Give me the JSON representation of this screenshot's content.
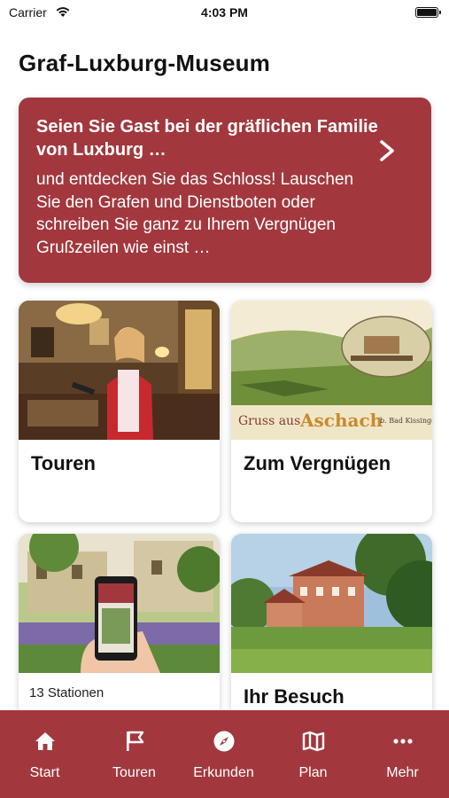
{
  "status_bar": {
    "carrier": "Carrier",
    "time": "4:03 PM"
  },
  "header": {
    "title": "Graf-Luxburg-Museum"
  },
  "hero": {
    "title": "Seien Sie Gast bei der gräflichen Familie von Luxburg …",
    "body": "und entdecken Sie das Schloss! Lauschen Sie den Grafen und Dienstboten oder schreiben Sie ganz zu Ihrem Vergnügen Grußzeilen wie einst …",
    "accent_color": "#a2383e"
  },
  "tiles": [
    {
      "label": "Touren",
      "image": "woman-with-tablet-in-museum-room"
    },
    {
      "label": "Zum Vergnügen",
      "image": "vintage-postcard-gruss-aus-aschach"
    },
    {
      "subtitle": "13 Stationen",
      "image": "smartphone-in-castle-garden"
    },
    {
      "label": "Ihr Besuch",
      "image": "castle-among-trees"
    }
  ],
  "tab_bar": {
    "items": [
      {
        "label": "Start",
        "icon": "home-icon"
      },
      {
        "label": "Touren",
        "icon": "flag-icon"
      },
      {
        "label": "Erkunden",
        "icon": "compass-icon"
      },
      {
        "label": "Plan",
        "icon": "map-icon"
      },
      {
        "label": "Mehr",
        "icon": "more-icon"
      }
    ]
  }
}
